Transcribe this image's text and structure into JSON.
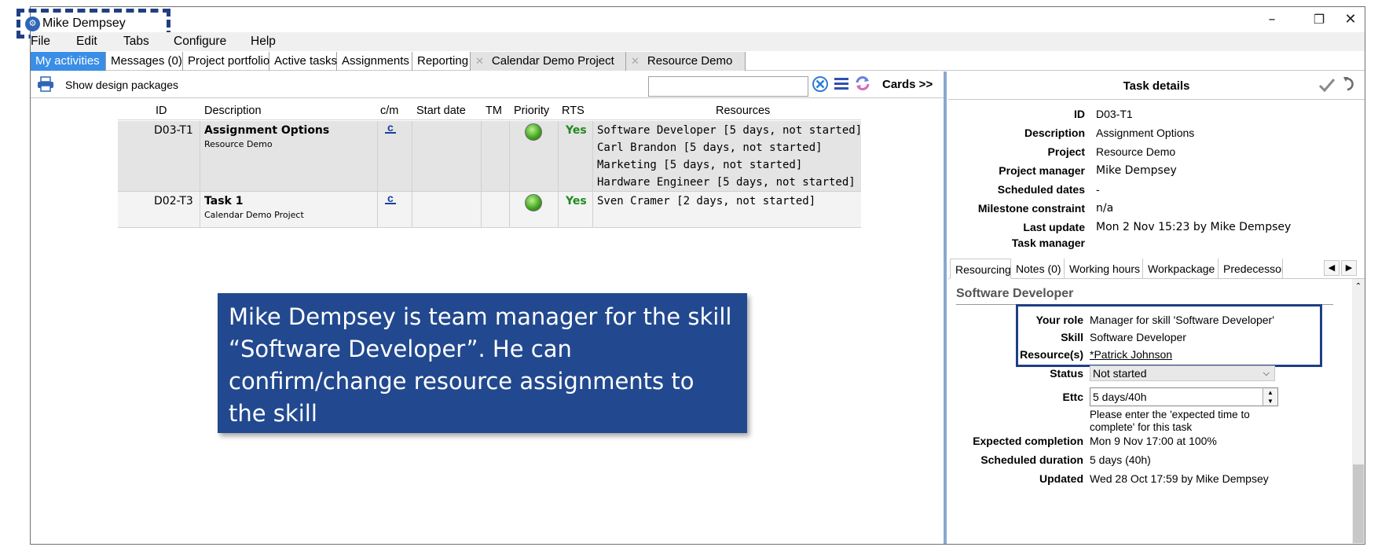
{
  "window": {
    "title": "Mike Dempsey",
    "minimize": "–",
    "restore": "❐",
    "close": "✕"
  },
  "menu": [
    "File",
    "Edit",
    "Tabs",
    "Configure",
    "Help"
  ],
  "tabs": [
    {
      "label": "My activities",
      "active": true,
      "closable": false
    },
    {
      "label": "Messages (0)",
      "active": false,
      "closable": false
    },
    {
      "label": "Project portfolio",
      "active": false,
      "closable": false
    },
    {
      "label": "Active tasks",
      "active": false,
      "closable": false
    },
    {
      "label": "Assignments",
      "active": false,
      "closable": false
    },
    {
      "label": "Reporting",
      "active": false,
      "closable": false
    },
    {
      "label": "Calendar Demo Project",
      "active": false,
      "closable": true
    },
    {
      "label": "Resource Demo",
      "active": false,
      "closable": true
    }
  ],
  "toolbar": {
    "show_design": "Show design packages",
    "search_value": "",
    "cards": "Cards >>"
  },
  "grid": {
    "headers": [
      "ID",
      "Description",
      "c/m",
      "Start date",
      "TM",
      "Priority",
      "RTS",
      "Resources"
    ],
    "rows": [
      {
        "id": "D03-T1",
        "title": "Assignment Options",
        "project": "Resource Demo",
        "cm": "c",
        "start": "",
        "tm": "",
        "rts": "Yes",
        "resources": [
          "Software Developer [5 days, not started]",
          "Carl Brandon [5 days, not started]",
          "Marketing [5 days, not started]",
          "Hardware Engineer [5 days, not started]"
        ]
      },
      {
        "id": "D02-T3",
        "title": "Task 1",
        "project": "Calendar Demo Project",
        "cm": "c",
        "start": "",
        "tm": "",
        "rts": "Yes",
        "resources": [
          "Sven Cramer [2 days, not started]"
        ]
      }
    ]
  },
  "callout": {
    "text": "Mike Dempsey is team manager for the skill “Software Developer”.  He can confirm/change resource assignments to the skill"
  },
  "details": {
    "title": "Task details",
    "fields": [
      {
        "key": "ID",
        "value": "D03-T1"
      },
      {
        "key": "Description",
        "value": "Assignment Options"
      },
      {
        "key": "Project",
        "value": "Resource Demo"
      },
      {
        "key": "Project manager",
        "value": "Mike Dempsey"
      },
      {
        "key": "Scheduled dates",
        "value": "-"
      },
      {
        "key": "Milestone constraint",
        "value": "n/a"
      },
      {
        "key": "Last update",
        "value": "Mon 2 Nov 15:23 by Mike Dempsey"
      },
      {
        "key": "Task manager",
        "value": ""
      }
    ],
    "subtabs": [
      "Resourcing",
      "Notes (0)",
      "Working hours",
      "Workpackage",
      "Predecessors"
    ],
    "section_title": "Software Developer",
    "your_role_label": "Your role",
    "your_role": "Manager for skill 'Software Developer'",
    "skill_label": "Skill",
    "skill": "Software Developer",
    "resources_label": "Resource(s)",
    "resources": "*Patrick Johnson",
    "status_label": "Status",
    "status": "Not started",
    "ettc_label": "Ettc",
    "ettc": "5 days/40h",
    "ettc_hint": "Please enter the 'expected time to complete' for this task",
    "expected_label": "Expected completion",
    "expected": "Mon 9 Nov 17:00 at 100%",
    "duration_label": "Scheduled duration",
    "duration": "5 days (40h)",
    "updated_label": "Updated",
    "updated": "Wed 28 Oct 17:59 by Mike Dempsey"
  },
  "colors": {
    "accent_tab": "#3a8ee6",
    "callout_bg": "#22498f",
    "highlight_border": "#1f3f84",
    "rts_green": "#1f8a1f"
  }
}
